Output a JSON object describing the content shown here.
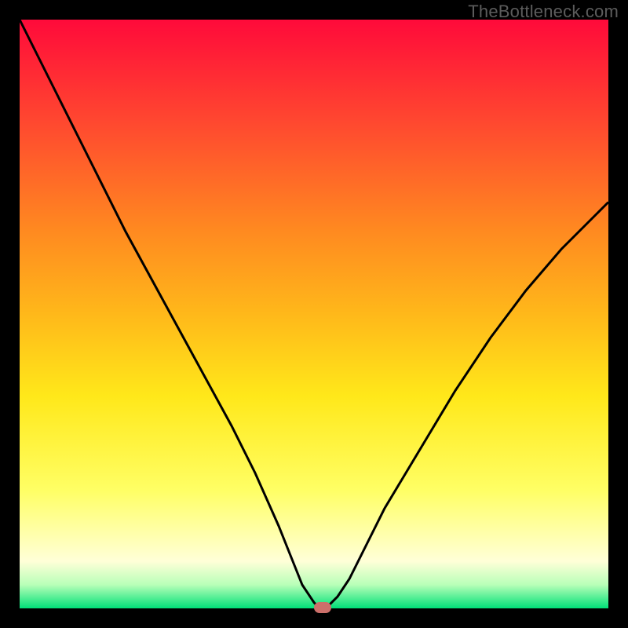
{
  "watermark": "TheBottleneck.com",
  "chart_data": {
    "type": "line",
    "title": "",
    "xlabel": "",
    "ylabel": "",
    "xlim": [
      0,
      100
    ],
    "ylim": [
      0,
      100
    ],
    "series": [
      {
        "name": "bottleneck-curve",
        "x": [
          0,
          6,
          12,
          18,
          24,
          30,
          36,
          40,
          44,
          46,
          48,
          50,
          51,
          52,
          54,
          56,
          58,
          62,
          68,
          74,
          80,
          86,
          92,
          98,
          100
        ],
        "values": [
          100,
          88,
          76,
          64,
          53,
          42,
          31,
          23,
          14,
          9,
          4,
          1,
          0,
          0,
          2,
          5,
          9,
          17,
          27,
          37,
          46,
          54,
          61,
          67,
          69
        ]
      }
    ],
    "marker": {
      "x": 51.5,
      "y": 0
    },
    "gradient_stops": [
      {
        "pct": 0,
        "color": "#ff0a3a"
      },
      {
        "pct": 18,
        "color": "#ff4a2f"
      },
      {
        "pct": 36,
        "color": "#ff8a20"
      },
      {
        "pct": 50,
        "color": "#ffb81a"
      },
      {
        "pct": 64,
        "color": "#ffe81a"
      },
      {
        "pct": 80,
        "color": "#ffff65"
      },
      {
        "pct": 92,
        "color": "#ffffd8"
      },
      {
        "pct": 96,
        "color": "#b8ffb8"
      },
      {
        "pct": 100,
        "color": "#00e078"
      }
    ]
  }
}
